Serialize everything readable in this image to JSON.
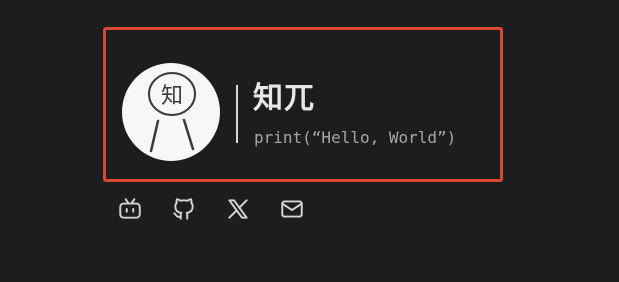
{
  "profile": {
    "avatar_glyph": "知",
    "name": "知兀",
    "tagline": "print(“Hello, World”)",
    "accent_color": "#d9492f",
    "background_color": "#1c1d1f"
  },
  "social": [
    {
      "name": "bilibili",
      "icon": "bilibili-icon"
    },
    {
      "name": "github",
      "icon": "github-icon"
    },
    {
      "name": "x",
      "icon": "x-icon"
    },
    {
      "name": "email",
      "icon": "mail-icon"
    }
  ]
}
